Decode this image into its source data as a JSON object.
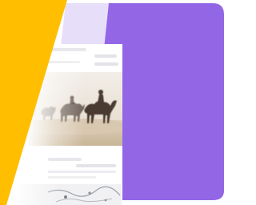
{
  "colors": {
    "background": "#ffffff",
    "lavender": "#e7def9",
    "purple": "#9366e6",
    "yellow": "#ffbf00",
    "card": "#ffffff",
    "placeholder_lines": "#e6e6ea",
    "sky": "#f1ece4",
    "sand": "#d7c7ae",
    "silhouette": "#4a3b31"
  },
  "scene": {
    "description_icons": [
      "camel-icon",
      "rider-icon"
    ]
  }
}
